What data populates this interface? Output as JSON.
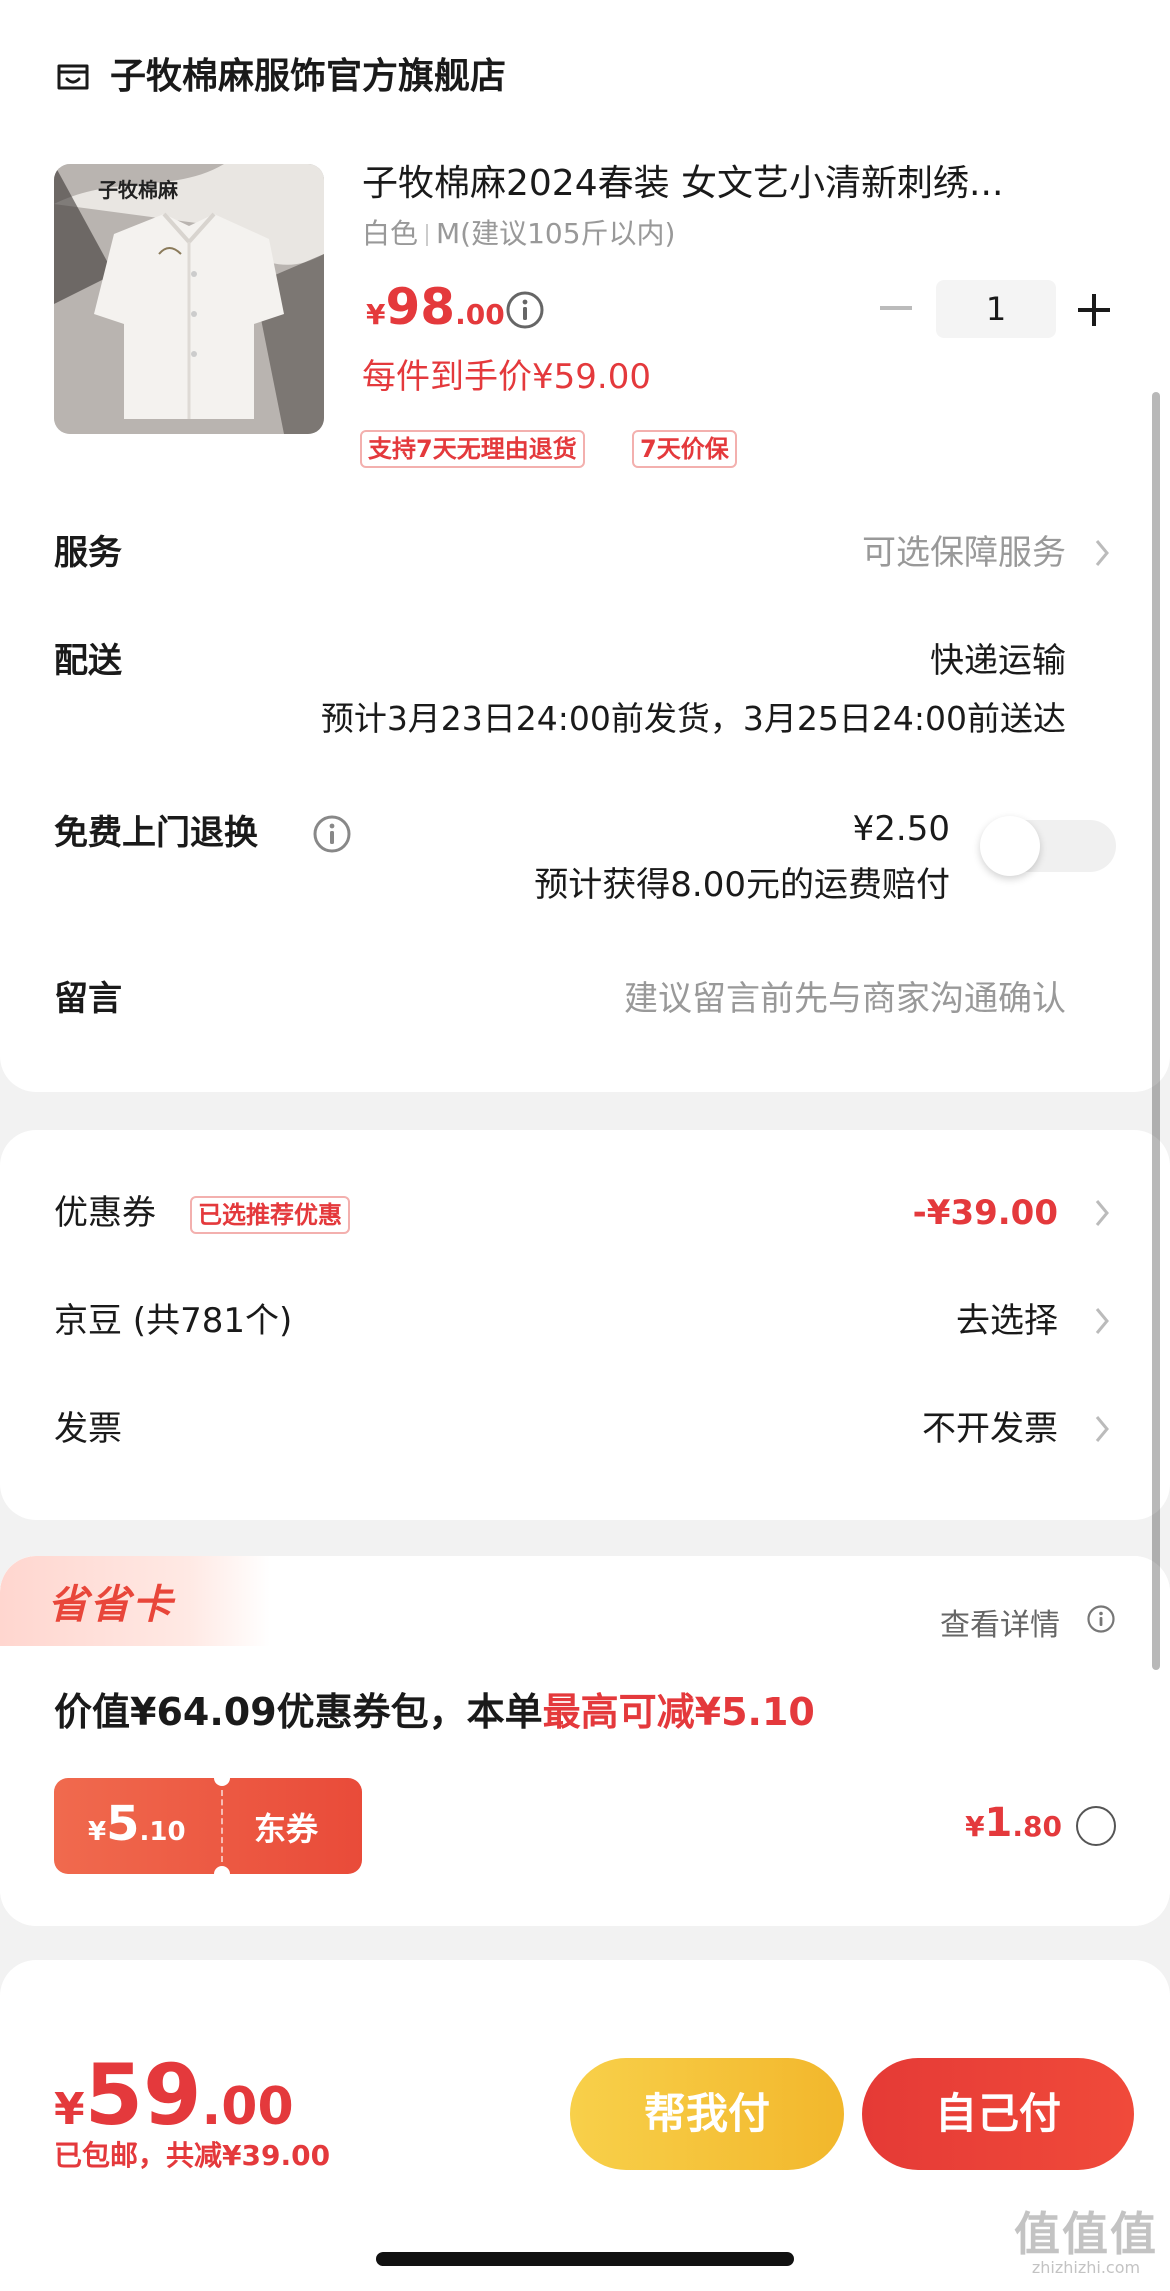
{
  "store": {
    "name": "子牧棉麻服饰官方旗舰店",
    "thumb_brand": "子牧棉麻"
  },
  "product": {
    "title": "子牧棉麻2024春装 女文艺小清新刺绣...",
    "spec_color": "白色",
    "spec_size": "M(建议105斤以内)",
    "price_symbol": "¥",
    "price_int": "98",
    "price_dec": ".00",
    "hand_price": "每件到手价¥59.00",
    "quantity": "1",
    "tags": [
      "支持7天无理由退货",
      "7天价保"
    ]
  },
  "rows": {
    "service_label": "服务",
    "service_value": "可选保障服务",
    "delivery_label": "配送",
    "delivery_method": "快递运输",
    "delivery_estimate": "预计3月23日24:00前发货，3月25日24:00前送达",
    "pickup_label": "免费上门退换",
    "pickup_price": "¥2.50",
    "pickup_note": "预计获得8.00元的运费赔付",
    "message_label": "留言",
    "message_placeholder": "建议留言前先与商家沟通确认"
  },
  "coupon": {
    "coupon_label": "优惠券",
    "coupon_tag": "已选推荐优惠",
    "coupon_value": "-¥39.00",
    "beans_label": "京豆 (共781个)",
    "beans_value": "去选择",
    "invoice_label": "发票",
    "invoice_value": "不开发票"
  },
  "saver": {
    "title": "省省卡",
    "detail": "查看详情",
    "desc_prefix": "价值¥64.09优惠券包，本单",
    "desc_highlight": "最高可减¥5.10",
    "ticket_symbol": "¥",
    "ticket_int": "5",
    "ticket_dec": ".10",
    "ticket_label": "东券",
    "price_symbol": "¥",
    "price_int": "1",
    "price_dec": ".80"
  },
  "bottom": {
    "total_symbol": "¥",
    "total_int": "59",
    "total_dec": ".00",
    "shipping_note": "已包邮",
    "discount_note": "，共减¥39.00",
    "help_pay": "帮我付",
    "self_pay": "自己付"
  },
  "watermark": {
    "main": "值值值",
    "sub": "zhizhizhi.com"
  },
  "colors": {
    "accent": "#e4393c",
    "help_button": "#f2b72c",
    "background": "#f2f2f2"
  }
}
